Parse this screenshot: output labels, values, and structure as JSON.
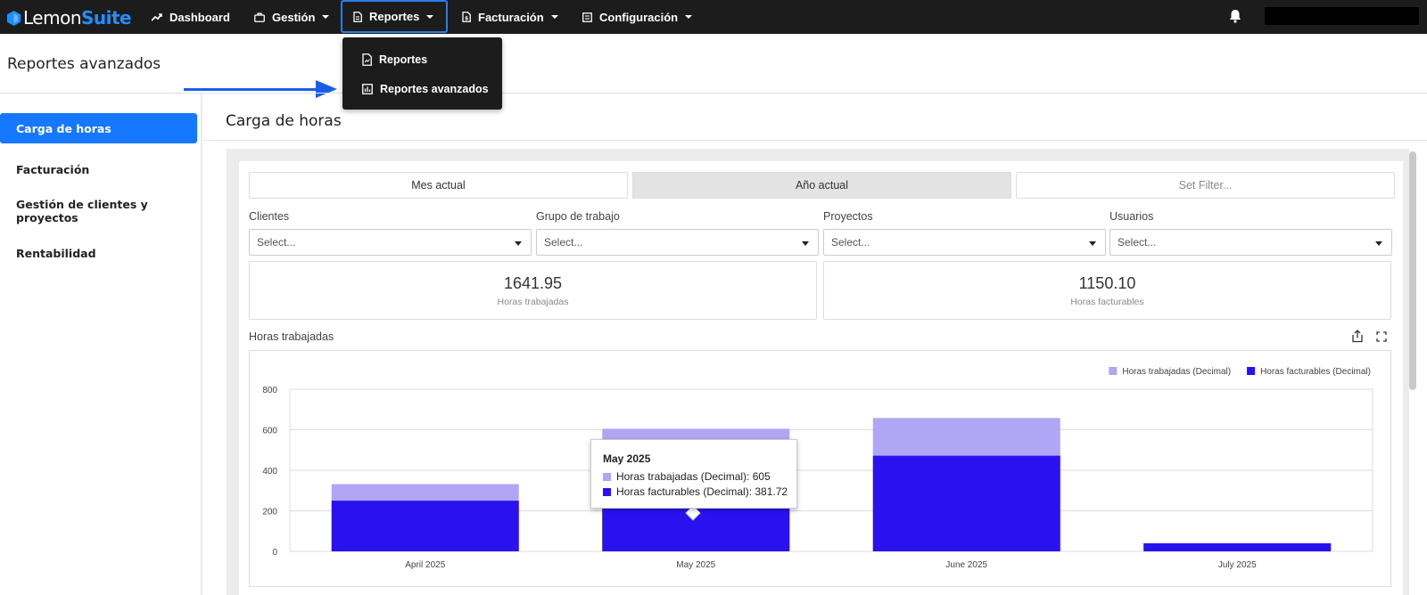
{
  "app": {
    "logo_part1": "Lemon",
    "logo_part2": "Suite"
  },
  "nav": {
    "items": [
      {
        "label": "Dashboard",
        "icon": "trend-line-icon"
      },
      {
        "label": "Gestión",
        "icon": "briefcase-icon"
      },
      {
        "label": "Reportes",
        "icon": "document-icon"
      },
      {
        "label": "Facturación",
        "icon": "invoice-icon"
      },
      {
        "label": "Configuración",
        "icon": "settings-list-icon"
      }
    ],
    "active": "Reportes"
  },
  "dropdown": {
    "items": [
      {
        "label": "Reportes",
        "icon": "report-file-icon"
      },
      {
        "label": "Reportes avanzados",
        "icon": "bar-chart-icon"
      }
    ]
  },
  "page": {
    "title": "Reportes avanzados"
  },
  "sidebar": {
    "items": [
      {
        "label": "Carga de horas",
        "active": true
      },
      {
        "label": "Facturación",
        "active": false
      },
      {
        "label": "Gestión de clientes y proyectos",
        "active": false
      },
      {
        "label": "Rentabilidad",
        "active": false
      }
    ]
  },
  "main": {
    "title": "Carga de horas",
    "period_buttons": [
      "Mes actual",
      "Año actual",
      "Set Filter..."
    ],
    "selected_period": "Año actual",
    "filters": [
      {
        "label": "Clientes",
        "placeholder": "Select..."
      },
      {
        "label": "Grupo de trabajo",
        "placeholder": "Select..."
      },
      {
        "label": "Proyectos",
        "placeholder": "Select..."
      },
      {
        "label": "Usuarios",
        "placeholder": "Select..."
      }
    ],
    "kpis": [
      {
        "value": "1641.95",
        "label": "Horas trabajadas"
      },
      {
        "value": "1150.10",
        "label": "Horas facturables"
      }
    ],
    "chart_title": "Horas trabajadas"
  },
  "tooltip": {
    "title": "May 2025",
    "rows": [
      {
        "label": "Horas trabajadas (Decimal): 605",
        "color": "#b0a6f5"
      },
      {
        "label": "Horas facturables (Decimal): 381.72",
        "color": "#2a12f0"
      }
    ]
  },
  "chart_data": {
    "type": "bar",
    "categories": [
      "April 2025",
      "May 2025",
      "June 2025",
      "July 2025"
    ],
    "series": [
      {
        "name": "Horas trabajadas (Decimal)",
        "color": "#b0a6f5",
        "values": [
          332,
          605,
          658,
          40
        ]
      },
      {
        "name": "Horas facturables (Decimal)",
        "color": "#2a12f0",
        "values": [
          250,
          381.72,
          472,
          40
        ]
      }
    ],
    "ylim": [
      0,
      800
    ],
    "yticks": [
      0,
      200,
      400,
      600,
      800
    ],
    "grid": true,
    "legend_position": "top-right"
  }
}
